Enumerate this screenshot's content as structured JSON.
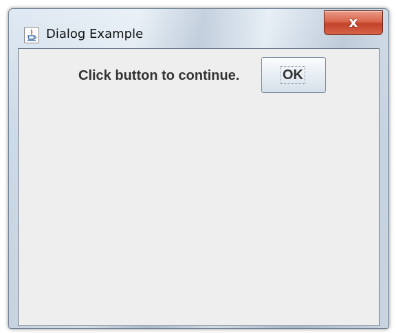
{
  "window": {
    "title": "Dialog Example",
    "app_icon": "java-coffee-cup-icon",
    "close_glyph": "x"
  },
  "content": {
    "prompt": "Click button to continue.",
    "ok_label": "OK"
  },
  "colors": {
    "close_button": "#d9664c",
    "client_background": "#eeeeee",
    "text": "#333333"
  }
}
